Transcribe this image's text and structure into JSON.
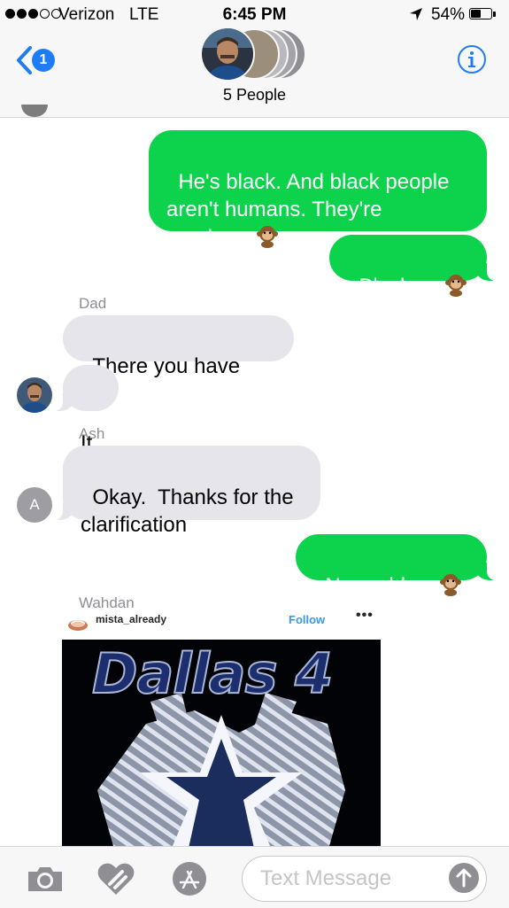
{
  "status_bar": {
    "carrier": "Verizon",
    "network": "LTE",
    "time": "6:45 PM",
    "battery": "54%",
    "battery_level": 0.54
  },
  "nav": {
    "back_badge": "1",
    "group_label": "5 People"
  },
  "messages": [
    {
      "dir": "out",
      "text": "He's black. And black people\naren't humans. They're\nmonkeys"
    },
    {
      "dir": "out",
      "text": "Blacks ="
    },
    {
      "dir": "in",
      "sender": "Dad",
      "text": "There you have our"
    },
    {
      "dir": "in",
      "text": "It"
    },
    {
      "dir": "in",
      "sender": "Ash",
      "text": "Okay.  Thanks for the\nclarification",
      "avatar_letter": "A"
    },
    {
      "dir": "out",
      "text": "No problem"
    },
    {
      "dir": "in",
      "sender": "Wahdan",
      "type": "instagram-post"
    }
  ],
  "instagram_post": {
    "username": "mista_already",
    "follow_label": "Follow",
    "more_label": "•••",
    "image_title": "Dallas 4"
  },
  "input_bar": {
    "placeholder": "Text Message"
  },
  "colors": {
    "outgoing_bubble": "#0dd34c",
    "incoming_bubble": "#e6e5eb",
    "accent": "#1f7cf7"
  }
}
